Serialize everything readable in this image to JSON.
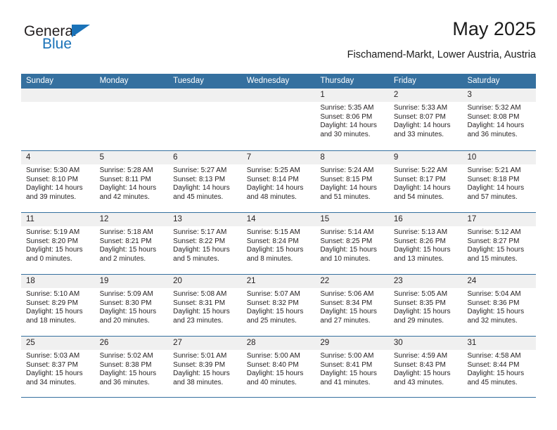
{
  "brand": {
    "name_top": "General",
    "name_bottom": "Blue"
  },
  "header": {
    "title": "May 2025",
    "subtitle": "Fischamend-Markt, Lower Austria, Austria"
  },
  "calendar": {
    "weekdays": [
      "Sunday",
      "Monday",
      "Tuesday",
      "Wednesday",
      "Thursday",
      "Friday",
      "Saturday"
    ],
    "accent_color": "#35709f",
    "day_band_color": "#f0f0f0",
    "weeks": [
      [
        {
          "empty": true
        },
        {
          "empty": true
        },
        {
          "empty": true
        },
        {
          "empty": true
        },
        {
          "day": "1",
          "sunrise": "Sunrise: 5:35 AM",
          "sunset": "Sunset: 8:06 PM",
          "daylight1": "Daylight: 14 hours",
          "daylight2": "and 30 minutes."
        },
        {
          "day": "2",
          "sunrise": "Sunrise: 5:33 AM",
          "sunset": "Sunset: 8:07 PM",
          "daylight1": "Daylight: 14 hours",
          "daylight2": "and 33 minutes."
        },
        {
          "day": "3",
          "sunrise": "Sunrise: 5:32 AM",
          "sunset": "Sunset: 8:08 PM",
          "daylight1": "Daylight: 14 hours",
          "daylight2": "and 36 minutes."
        }
      ],
      [
        {
          "day": "4",
          "sunrise": "Sunrise: 5:30 AM",
          "sunset": "Sunset: 8:10 PM",
          "daylight1": "Daylight: 14 hours",
          "daylight2": "and 39 minutes."
        },
        {
          "day": "5",
          "sunrise": "Sunrise: 5:28 AM",
          "sunset": "Sunset: 8:11 PM",
          "daylight1": "Daylight: 14 hours",
          "daylight2": "and 42 minutes."
        },
        {
          "day": "6",
          "sunrise": "Sunrise: 5:27 AM",
          "sunset": "Sunset: 8:13 PM",
          "daylight1": "Daylight: 14 hours",
          "daylight2": "and 45 minutes."
        },
        {
          "day": "7",
          "sunrise": "Sunrise: 5:25 AM",
          "sunset": "Sunset: 8:14 PM",
          "daylight1": "Daylight: 14 hours",
          "daylight2": "and 48 minutes."
        },
        {
          "day": "8",
          "sunrise": "Sunrise: 5:24 AM",
          "sunset": "Sunset: 8:15 PM",
          "daylight1": "Daylight: 14 hours",
          "daylight2": "and 51 minutes."
        },
        {
          "day": "9",
          "sunrise": "Sunrise: 5:22 AM",
          "sunset": "Sunset: 8:17 PM",
          "daylight1": "Daylight: 14 hours",
          "daylight2": "and 54 minutes."
        },
        {
          "day": "10",
          "sunrise": "Sunrise: 5:21 AM",
          "sunset": "Sunset: 8:18 PM",
          "daylight1": "Daylight: 14 hours",
          "daylight2": "and 57 minutes."
        }
      ],
      [
        {
          "day": "11",
          "sunrise": "Sunrise: 5:19 AM",
          "sunset": "Sunset: 8:20 PM",
          "daylight1": "Daylight: 15 hours",
          "daylight2": "and 0 minutes."
        },
        {
          "day": "12",
          "sunrise": "Sunrise: 5:18 AM",
          "sunset": "Sunset: 8:21 PM",
          "daylight1": "Daylight: 15 hours",
          "daylight2": "and 2 minutes."
        },
        {
          "day": "13",
          "sunrise": "Sunrise: 5:17 AM",
          "sunset": "Sunset: 8:22 PM",
          "daylight1": "Daylight: 15 hours",
          "daylight2": "and 5 minutes."
        },
        {
          "day": "14",
          "sunrise": "Sunrise: 5:15 AM",
          "sunset": "Sunset: 8:24 PM",
          "daylight1": "Daylight: 15 hours",
          "daylight2": "and 8 minutes."
        },
        {
          "day": "15",
          "sunrise": "Sunrise: 5:14 AM",
          "sunset": "Sunset: 8:25 PM",
          "daylight1": "Daylight: 15 hours",
          "daylight2": "and 10 minutes."
        },
        {
          "day": "16",
          "sunrise": "Sunrise: 5:13 AM",
          "sunset": "Sunset: 8:26 PM",
          "daylight1": "Daylight: 15 hours",
          "daylight2": "and 13 minutes."
        },
        {
          "day": "17",
          "sunrise": "Sunrise: 5:12 AM",
          "sunset": "Sunset: 8:27 PM",
          "daylight1": "Daylight: 15 hours",
          "daylight2": "and 15 minutes."
        }
      ],
      [
        {
          "day": "18",
          "sunrise": "Sunrise: 5:10 AM",
          "sunset": "Sunset: 8:29 PM",
          "daylight1": "Daylight: 15 hours",
          "daylight2": "and 18 minutes."
        },
        {
          "day": "19",
          "sunrise": "Sunrise: 5:09 AM",
          "sunset": "Sunset: 8:30 PM",
          "daylight1": "Daylight: 15 hours",
          "daylight2": "and 20 minutes."
        },
        {
          "day": "20",
          "sunrise": "Sunrise: 5:08 AM",
          "sunset": "Sunset: 8:31 PM",
          "daylight1": "Daylight: 15 hours",
          "daylight2": "and 23 minutes."
        },
        {
          "day": "21",
          "sunrise": "Sunrise: 5:07 AM",
          "sunset": "Sunset: 8:32 PM",
          "daylight1": "Daylight: 15 hours",
          "daylight2": "and 25 minutes."
        },
        {
          "day": "22",
          "sunrise": "Sunrise: 5:06 AM",
          "sunset": "Sunset: 8:34 PM",
          "daylight1": "Daylight: 15 hours",
          "daylight2": "and 27 minutes."
        },
        {
          "day": "23",
          "sunrise": "Sunrise: 5:05 AM",
          "sunset": "Sunset: 8:35 PM",
          "daylight1": "Daylight: 15 hours",
          "daylight2": "and 29 minutes."
        },
        {
          "day": "24",
          "sunrise": "Sunrise: 5:04 AM",
          "sunset": "Sunset: 8:36 PM",
          "daylight1": "Daylight: 15 hours",
          "daylight2": "and 32 minutes."
        }
      ],
      [
        {
          "day": "25",
          "sunrise": "Sunrise: 5:03 AM",
          "sunset": "Sunset: 8:37 PM",
          "daylight1": "Daylight: 15 hours",
          "daylight2": "and 34 minutes."
        },
        {
          "day": "26",
          "sunrise": "Sunrise: 5:02 AM",
          "sunset": "Sunset: 8:38 PM",
          "daylight1": "Daylight: 15 hours",
          "daylight2": "and 36 minutes."
        },
        {
          "day": "27",
          "sunrise": "Sunrise: 5:01 AM",
          "sunset": "Sunset: 8:39 PM",
          "daylight1": "Daylight: 15 hours",
          "daylight2": "and 38 minutes."
        },
        {
          "day": "28",
          "sunrise": "Sunrise: 5:00 AM",
          "sunset": "Sunset: 8:40 PM",
          "daylight1": "Daylight: 15 hours",
          "daylight2": "and 40 minutes."
        },
        {
          "day": "29",
          "sunrise": "Sunrise: 5:00 AM",
          "sunset": "Sunset: 8:41 PM",
          "daylight1": "Daylight: 15 hours",
          "daylight2": "and 41 minutes."
        },
        {
          "day": "30",
          "sunrise": "Sunrise: 4:59 AM",
          "sunset": "Sunset: 8:43 PM",
          "daylight1": "Daylight: 15 hours",
          "daylight2": "and 43 minutes."
        },
        {
          "day": "31",
          "sunrise": "Sunrise: 4:58 AM",
          "sunset": "Sunset: 8:44 PM",
          "daylight1": "Daylight: 15 hours",
          "daylight2": "and 45 minutes."
        }
      ]
    ]
  }
}
